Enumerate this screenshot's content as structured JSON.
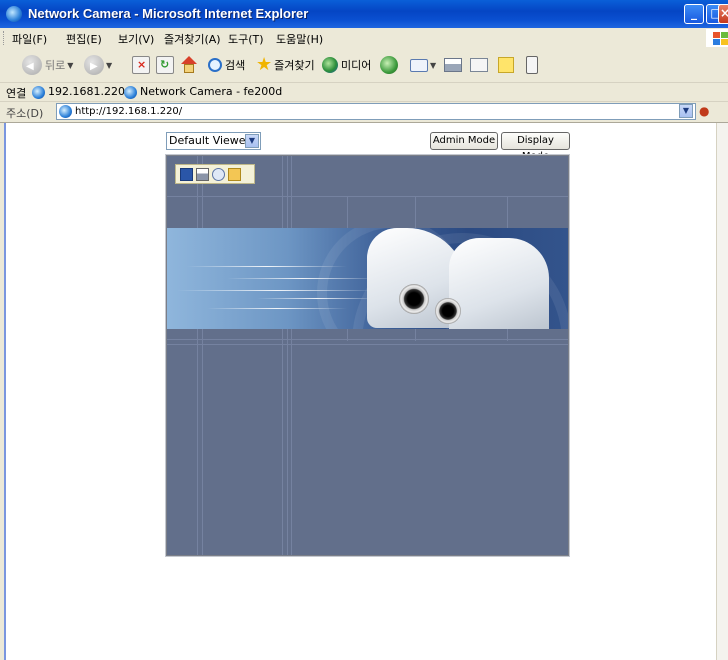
{
  "window": {
    "title": "Network Camera - Microsoft Internet Explorer"
  },
  "menubar": {
    "items": [
      "파일(F)",
      "편집(E)",
      "보기(V)",
      "즐겨찾기(A)",
      "도구(T)",
      "도움말(H)"
    ]
  },
  "toolbar": {
    "back_label": "뒤로",
    "search_label": "검색",
    "favorites_label": "즐겨찾기",
    "media_label": "미디어"
  },
  "links": {
    "label": "연결",
    "items": [
      "192.1681.220",
      "Network Camera - fe200d"
    ]
  },
  "address": {
    "label": "주소(D)",
    "url": "http://192.168.1.220/"
  },
  "viewer": {
    "selected": "Default Viewer",
    "admin_mode_label": "Admin Mode",
    "display_mode_label": "Display Mode"
  },
  "colors": {
    "titlebar": "#0545c4",
    "panel_bg": "#626f8b",
    "chrome_bg": "#ece9d8"
  }
}
